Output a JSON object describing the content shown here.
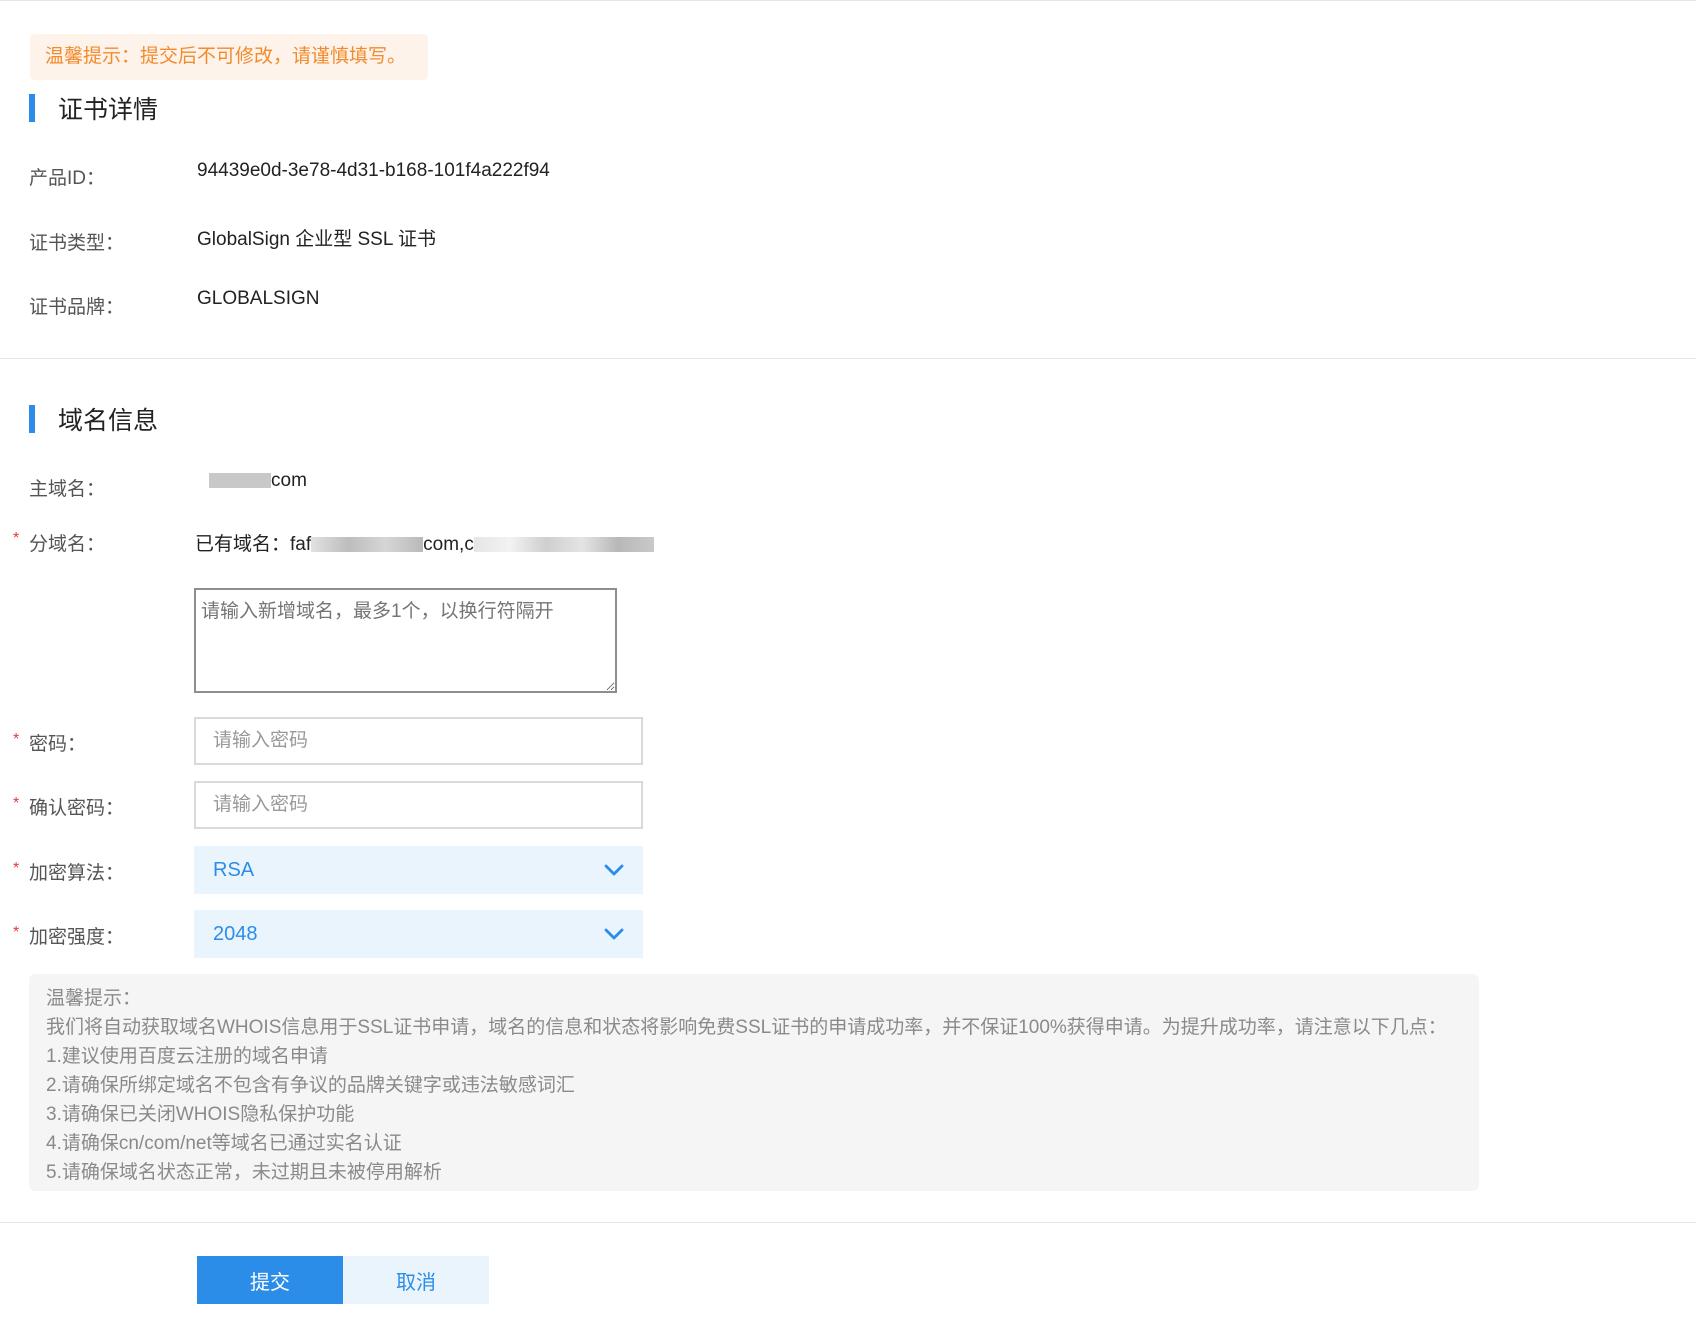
{
  "warning_banner": "温馨提示：提交后不可修改，请谨慎填写。",
  "cert_section": {
    "title": "证书详情",
    "rows": [
      {
        "label": "产品ID：",
        "value": "94439e0d-3e78-4d31-b168-101f4a222f94"
      },
      {
        "label": "证书类型：",
        "value": "GlobalSign 企业型 SSL 证书"
      },
      {
        "label": "证书品牌：",
        "value": "GLOBALSIGN"
      }
    ]
  },
  "domain_section": {
    "title": "域名信息",
    "main_domain_label": "主域名：",
    "main_domain_suffix": "com",
    "sub_domain_label": "分域名：",
    "existing_prefix": "已有域名：",
    "existing_start": "faf",
    "existing_mid": "com,c",
    "new_domain_placeholder": "请输入新增域名，最多1个，以换行符隔开",
    "password_label": "密码：",
    "password_placeholder": "请输入密码",
    "confirm_label": "确认密码：",
    "confirm_placeholder": "请输入密码",
    "algorithm_label": "加密算法：",
    "algorithm_value": "RSA",
    "strength_label": "加密强度：",
    "strength_value": "2048",
    "required_mark": "*"
  },
  "tips": {
    "title": "温馨提示：",
    "lines": [
      "我们将自动获取域名WHOIS信息用于SSL证书申请，域名的信息和状态将影响免费SSL证书的申请成功率，并不保证100%获得申请。为提升成功率，请注意以下几点：",
      "1.建议使用百度云注册的域名申请",
      "2.请确保所绑定域名不包含有争议的品牌关键字或违法敏感词汇",
      "3.请确保已关闭WHOIS隐私保护功能",
      "4.请确保cn/com/net等域名已通过实名认证",
      "5.请确保域名状态正常，未过期且未被停用解析"
    ]
  },
  "actions": {
    "submit": "提交",
    "cancel": "取消"
  },
  "colors": {
    "accent": "#2b8de8",
    "warning": "#f38b2d",
    "required": "#e4393c"
  }
}
